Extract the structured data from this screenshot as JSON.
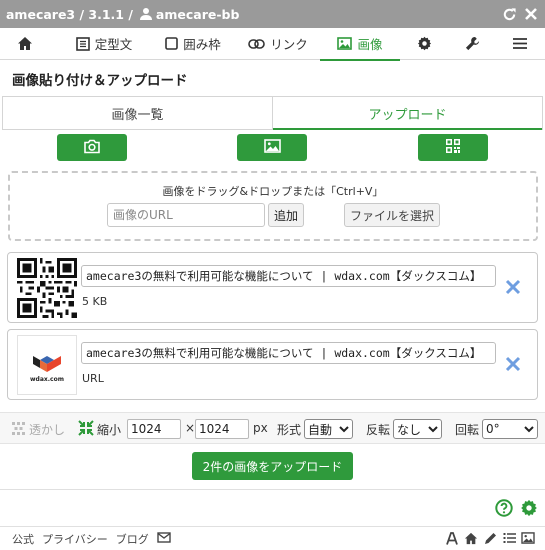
{
  "window": {
    "title": "amecare3 / 3.1.1 /",
    "user": "amecare-bb"
  },
  "tabs": [
    {
      "icon": "home-icon",
      "label": ""
    },
    {
      "icon": "template-icon",
      "label": "定型文"
    },
    {
      "icon": "frame-icon",
      "label": "囲み枠"
    },
    {
      "icon": "link-icon",
      "label": "リンク"
    },
    {
      "icon": "image-icon",
      "label": "画像",
      "active": true
    },
    {
      "icon": "gear-icon",
      "label": ""
    },
    {
      "icon": "wrench-icon",
      "label": ""
    },
    {
      "icon": "menu-icon",
      "label": ""
    }
  ],
  "section": {
    "title": "画像貼り付け＆アップロード"
  },
  "subtabs": [
    {
      "label": "画像一覧"
    },
    {
      "label": "アップロード",
      "active": true
    }
  ],
  "dropzone": {
    "instruction": "画像をドラッグ&ドロップまたは「Ctrl+V」",
    "url_placeholder": "画像のURL",
    "add_label": "追加",
    "file_label": "ファイルを選択"
  },
  "items": [
    {
      "title": "amecare3の無料で利用可能な機能について | wdax.com【ダックスコム】",
      "meta": "5 KB",
      "thumb": "qr-code"
    },
    {
      "title": "amecare3の無料で利用可能な機能について | wdax.com【ダックスコム】",
      "meta": "URL",
      "thumb": "wdax-logo",
      "logo_text": "wdax.com"
    }
  ],
  "options": {
    "watermark_label": "透かし",
    "shrink_label": "縮小",
    "width": "1024",
    "times": "×",
    "height": "1024",
    "unit": "px",
    "format_label": "形式",
    "format_value": "自動",
    "flip_label": "反転",
    "flip_value": "なし",
    "rotate_label": "回転",
    "rotate_value": "0°"
  },
  "upload_button": "2件の画像をアップロード",
  "footer": {
    "links": [
      "公式",
      "プライバシー",
      "ブログ"
    ]
  },
  "colors": {
    "accent": "#2f9a3c",
    "titlebar": "#9a9a9a",
    "delete": "#6f9ee0"
  }
}
